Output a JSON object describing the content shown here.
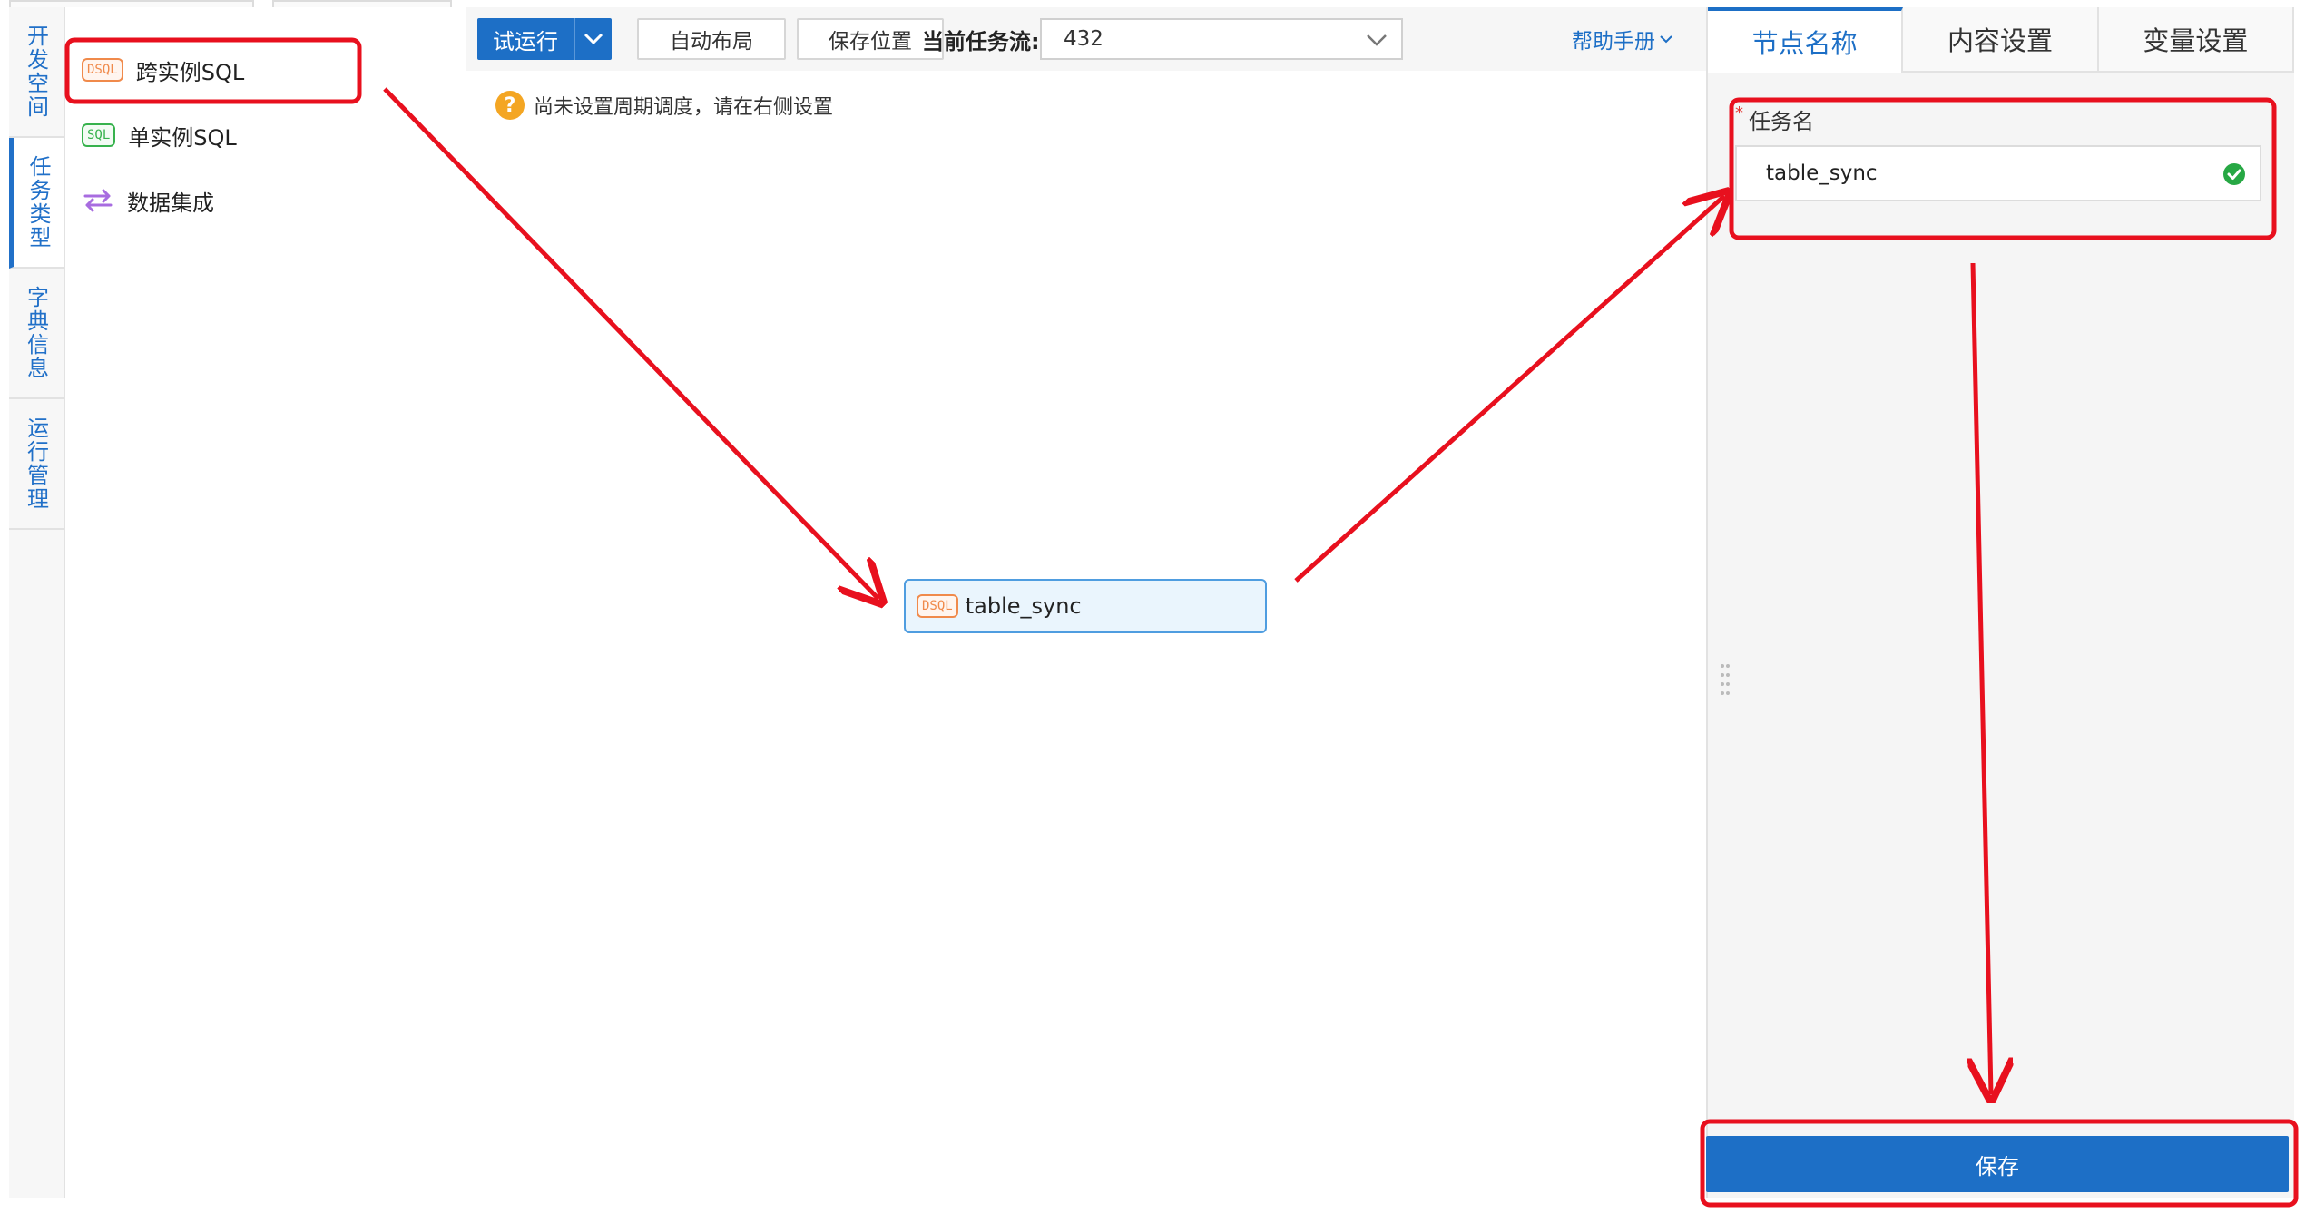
{
  "side_tabs": [
    {
      "label": "开发空间",
      "active": false
    },
    {
      "label": "任务类型",
      "active": true
    },
    {
      "label": "字典信息",
      "active": false
    },
    {
      "label": "运行管理",
      "active": false
    }
  ],
  "task_types": [
    {
      "badge": "DSQL",
      "label": "跨实例SQL",
      "icon": "dsql-badge-icon"
    },
    {
      "badge": "SQL",
      "label": "单实例SQL",
      "icon": "sql-badge-icon"
    },
    {
      "badge": "",
      "label": "数据集成",
      "icon": "sync-arrows-icon"
    }
  ],
  "toolbar": {
    "run_label": "试运行",
    "auto_layout_label": "自动布局",
    "save_position_label": "保存位置",
    "current_flow_label": "当前任务流:",
    "current_flow_value": "432",
    "help_label": "帮助手册"
  },
  "notice": {
    "icon": "?",
    "text": "尚未设置周期调度，请在右侧设置"
  },
  "canvas_node": {
    "badge": "DSQL",
    "label": "table_sync"
  },
  "right_panel": {
    "tabs": [
      {
        "label": "节点名称",
        "active": true
      },
      {
        "label": "内容设置",
        "active": false
      },
      {
        "label": "变量设置",
        "active": false
      }
    ],
    "required_mark": "*",
    "field_label": "任务名",
    "field_value": "table_sync",
    "save_label": "保存"
  },
  "colors": {
    "primary": "#1d6fc6",
    "annotation": "#e8101e",
    "dsql_badge": "#f08a4b",
    "sql_badge": "#37b24d",
    "sync_icon": "#a86ce0",
    "valid_check": "#27a844",
    "warning": "#f4a623"
  }
}
